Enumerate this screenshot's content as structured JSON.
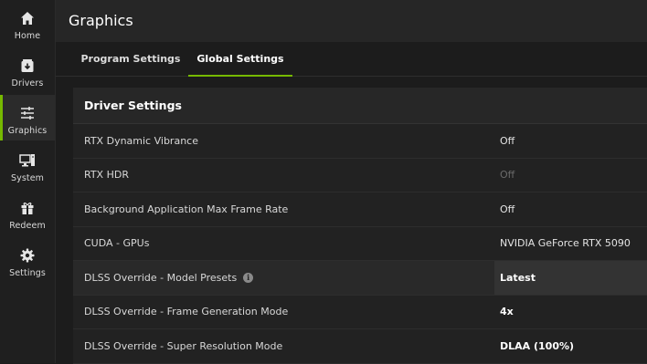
{
  "sidebar": {
    "items": [
      {
        "label": "Home",
        "icon": "home-icon"
      },
      {
        "label": "Drivers",
        "icon": "download-box-icon"
      },
      {
        "label": "Graphics",
        "icon": "sliders-icon",
        "active": true
      },
      {
        "label": "System",
        "icon": "monitor-icon"
      },
      {
        "label": "Redeem",
        "icon": "gift-icon"
      },
      {
        "label": "Settings",
        "icon": "gear-icon"
      }
    ]
  },
  "header": {
    "title": "Graphics"
  },
  "tabs": [
    {
      "label": "Program Settings",
      "active": false
    },
    {
      "label": "Global Settings",
      "active": true
    }
  ],
  "driver_settings": {
    "title": "Driver Settings",
    "rows": [
      {
        "name": "RTX Dynamic Vibrance",
        "value": "Off"
      },
      {
        "name": "RTX HDR",
        "value": "Off"
      },
      {
        "name": "Background Application Max Frame Rate",
        "value": "Off"
      },
      {
        "name": "CUDA - GPUs",
        "value": "NVIDIA GeForce RTX 5090"
      },
      {
        "name": "DLSS Override - Model Presets",
        "value": "Latest"
      },
      {
        "name": "DLSS Override - Frame Generation Mode",
        "value": "4x"
      },
      {
        "name": "DLSS Override - Super Resolution Mode",
        "value": "DLAA (100%)"
      }
    ]
  },
  "colors": {
    "accent": "#76b900"
  }
}
